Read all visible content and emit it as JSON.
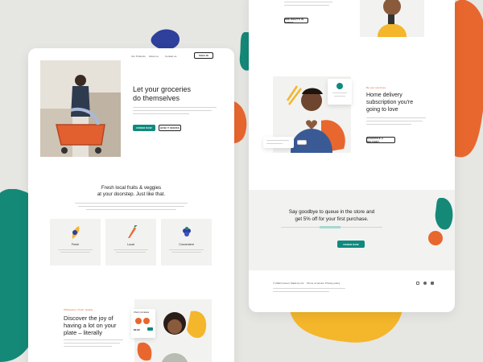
{
  "colors": {
    "teal": "#0f8a7e",
    "orange": "#e8672e",
    "yellow": "#f4b62a",
    "purple": "#2e3f9c",
    "bg": "#e6e6e3",
    "panel": "#f2f2f0"
  },
  "nav": {
    "links": [
      "Our Products",
      "About us",
      "Contact us"
    ],
    "cta": "SIGN IN"
  },
  "hero": {
    "title_line1": "Let your groceries",
    "title_line2": "do themselves",
    "primary_btn": "ORDER NOW",
    "secondary_btn": "HOW IT WORKS"
  },
  "intro": {
    "line1": "Fresh local fruits & veggies",
    "line2": "at your doorstep. Just like that."
  },
  "features": [
    {
      "title": "Fresh",
      "icon": "banana-icon"
    },
    {
      "title": "Local",
      "icon": "carrot-icon"
    },
    {
      "title": "Convenient",
      "icon": "grapes-icon"
    }
  ],
  "joy": {
    "eyebrow": "Wholesome. Fresh. Quality.",
    "line1": "Discover the joy of",
    "line2": "having a lot on your",
    "line3": "plate – literally",
    "product_card": "Cherry tomatoes",
    "product_price": "$2.99"
  },
  "delivery": {
    "eyebrow": "Be your own boss.",
    "line1": "Home delivery",
    "line2": "subscription you're",
    "line3": "going to love",
    "btn": "SCHEDULE A DELIVERY",
    "top_btn": "SEE WHAT'S IN STOCK"
  },
  "promo": {
    "line1": "Say goodbye to queue in the store and",
    "line2": "get 5% off for your first purchase.",
    "btn": "ORDER NOW"
  },
  "footer": {
    "copyright": "© 2020 Grocer | Made by Iris",
    "links": [
      "Terms of service",
      "Privacy policy"
    ],
    "social": [
      "instagram-icon",
      "twitter-icon",
      "facebook-icon"
    ]
  }
}
